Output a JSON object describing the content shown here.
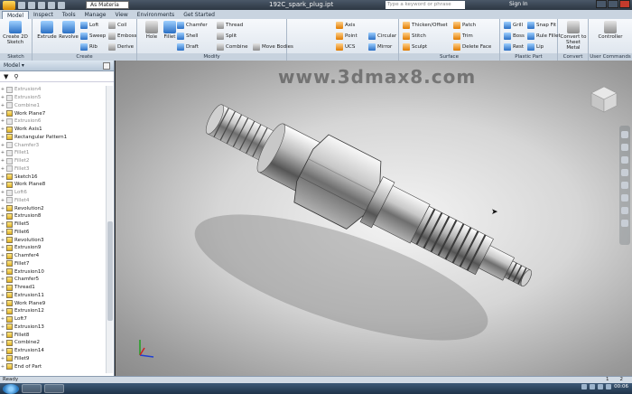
{
  "window": {
    "title": "192C_spark_plug.ipt",
    "material": "As Materia",
    "search_placeholder": "Type a keyword or phrase",
    "sign_in": "Sign In"
  },
  "tabs": [
    "Model",
    "Inspect",
    "Tools",
    "Manage",
    "View",
    "Environments",
    "Get Started"
  ],
  "ribbon": {
    "sketch": {
      "create_2d_sketch": "Create 2D Sketch",
      "footer": "Sketch"
    },
    "create": {
      "extrude": "Extrude",
      "revolve": "Revolve",
      "loft": "Loft",
      "sweep": "Sweep",
      "rib": "Rib",
      "coil": "Coil",
      "emboss": "Emboss",
      "derive": "Derive",
      "footer": "Create"
    },
    "modify": {
      "hole": "Hole",
      "fillet": "Fillet",
      "chamfer": "Chamfer",
      "shell": "Shell",
      "draft": "Draft",
      "thread": "Thread",
      "split": "Split",
      "combine": "Combine",
      "move_bodies": "Move Bodies",
      "footer": "Modify"
    },
    "work_features": {
      "axis": "Axis",
      "point": "Point",
      "ucs": "UCS"
    },
    "pattern": {
      "circular": "Circular",
      "mirror": "Mirror"
    },
    "surface": {
      "thicken_offset": "Thicken/Offset",
      "stitch": "Stitch",
      "sculpt": "Sculpt",
      "patch": "Patch",
      "trim": "Trim",
      "delete_face": "Delete Face",
      "footer": "Surface"
    },
    "plastic_part": {
      "grill": "Grill",
      "boss": "Boss",
      "rest": "Rest",
      "snap_fit": "Snap Fit",
      "rule_fillet": "Rule Fillet",
      "lip": "Lip",
      "footer": "Plastic Part"
    },
    "convert": {
      "convert_to_sheet_metal": "Convert to Sheet Metal",
      "footer": "Convert"
    },
    "user_commands": {
      "controller": "Controller",
      "footer": "User Commands"
    }
  },
  "browser": {
    "title": "Model",
    "tree": [
      {
        "label": "Extrusion4",
        "dim": true
      },
      {
        "label": "Extrusion5",
        "dim": true
      },
      {
        "label": "Combine1",
        "dim": true
      },
      {
        "label": "Work Plane7",
        "dim": false
      },
      {
        "label": "Extrusion6",
        "dim": true
      },
      {
        "label": "Work Axis1",
        "dim": false
      },
      {
        "label": "Rectangular Pattern1",
        "dim": false
      },
      {
        "label": "Chamfer3",
        "dim": true
      },
      {
        "label": "Fillet1",
        "dim": true
      },
      {
        "label": "Fillet2",
        "dim": true
      },
      {
        "label": "Fillet3",
        "dim": true
      },
      {
        "label": "Sketch16",
        "dim": false
      },
      {
        "label": "Work Plane8",
        "dim": false
      },
      {
        "label": "Loft6",
        "dim": true
      },
      {
        "label": "Fillet4",
        "dim": true
      },
      {
        "label": "Revolution2",
        "dim": false
      },
      {
        "label": "Extrusion8",
        "dim": false
      },
      {
        "label": "Fillet5",
        "dim": false
      },
      {
        "label": "Fillet6",
        "dim": false
      },
      {
        "label": "Revolution3",
        "dim": false
      },
      {
        "label": "Extrusion9",
        "dim": false
      },
      {
        "label": "Chamfer4",
        "dim": false
      },
      {
        "label": "Fillet7",
        "dim": false
      },
      {
        "label": "Extrusion10",
        "dim": false
      },
      {
        "label": "Chamfer5",
        "dim": false
      },
      {
        "label": "Thread1",
        "dim": false
      },
      {
        "label": "Extrusion11",
        "dim": false
      },
      {
        "label": "Work Plane9",
        "dim": false
      },
      {
        "label": "Extrusion12",
        "dim": false
      },
      {
        "label": "Loft7",
        "dim": false
      },
      {
        "label": "Extrusion13",
        "dim": false
      },
      {
        "label": "Fillet8",
        "dim": false
      },
      {
        "label": "Combine2",
        "dim": false
      },
      {
        "label": "Extrusion14",
        "dim": false
      },
      {
        "label": "Fillet9",
        "dim": false
      },
      {
        "label": "End of Part",
        "dim": false
      }
    ]
  },
  "viewport": {
    "watermark": "www.3dmax8.com",
    "viewcube_label": "RIGHT"
  },
  "status": {
    "text": "Ready",
    "count1": "1",
    "count2": "2"
  },
  "taskbar": {
    "clock": "00:06"
  },
  "colors": {
    "accent": "#2a6fc4",
    "ribbon_bg": "#dbe3ec",
    "titlebar": "#2c3642"
  }
}
